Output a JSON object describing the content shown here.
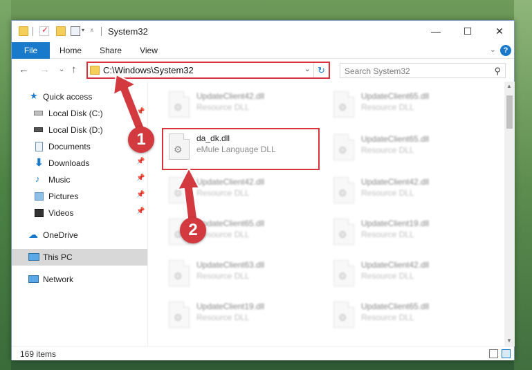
{
  "window": {
    "title": "System32",
    "controls": {
      "minimize": "—",
      "maximize": "☐",
      "close": "✕"
    }
  },
  "ribbon": {
    "tabs": [
      "File",
      "Home",
      "Share",
      "View"
    ],
    "help": "?",
    "collapse": "⌄"
  },
  "address": {
    "path": "C:\\Windows\\System32",
    "dropdown": "⌄",
    "refresh": "↻"
  },
  "search": {
    "placeholder": "Search System32",
    "icon": "⚲"
  },
  "nav": {
    "back": "←",
    "forward": "→",
    "recent": "⌄",
    "up": "↑",
    "items": [
      {
        "label": "Quick access",
        "icon": "star-icon"
      },
      {
        "label": "Local Disk (C:)",
        "icon": "drive-icon",
        "pinned": true
      },
      {
        "label": "Local Disk (D:)",
        "icon": "drive-icon"
      },
      {
        "label": "Documents",
        "icon": "document-icon"
      },
      {
        "label": "Downloads",
        "icon": "download-icon",
        "pinned": true
      },
      {
        "label": "Music",
        "icon": "music-icon",
        "pinned": true
      },
      {
        "label": "Pictures",
        "icon": "picture-icon",
        "pinned": true
      },
      {
        "label": "Videos",
        "icon": "video-icon",
        "pinned": true
      },
      {
        "label": "OneDrive",
        "icon": "cloud-icon"
      },
      {
        "label": "This PC",
        "icon": "computer-icon",
        "selected": true
      },
      {
        "label": "Network",
        "icon": "network-icon"
      }
    ]
  },
  "files": {
    "highlighted": {
      "name": "da_dk.dll",
      "desc": "eMule Language DLL"
    },
    "col1": [
      {
        "name": "UpdateClient42.dll",
        "desc": "Resource DLL"
      },
      {
        "name": "UpdateClient42.dll",
        "desc": "Resource DLL"
      },
      {
        "name": "UpdateClient65.dll",
        "desc": "Resource DLL"
      },
      {
        "name": "UpdateClient63.dll",
        "desc": "Resource DLL"
      },
      {
        "name": "UpdateClient19.dll",
        "desc": "Resource DLL"
      }
    ],
    "col2": [
      {
        "name": "UpdateClient65.dll",
        "desc": "Resource DLL"
      },
      {
        "name": "UpdateClient65.dll",
        "desc": "Resource DLL"
      },
      {
        "name": "UpdateClient42.dll",
        "desc": "Resource DLL"
      },
      {
        "name": "UpdateClient19.dll",
        "desc": "Resource DLL"
      },
      {
        "name": "UpdateClient42.dll",
        "desc": "Resource DLL"
      },
      {
        "name": "UpdateClient65.dll",
        "desc": "Resource DLL"
      }
    ]
  },
  "status": {
    "count": "169 items"
  },
  "annotations": {
    "step1": "1",
    "step2": "2"
  },
  "colors": {
    "accent": "#1979ca",
    "highlight": "#d9343d",
    "callout": "#d23a3f"
  }
}
